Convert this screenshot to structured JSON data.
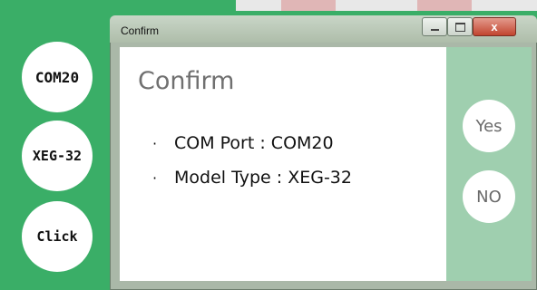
{
  "left_buttons": {
    "port": "COM20",
    "model": "XEG-32",
    "click": "Click"
  },
  "window": {
    "title": "Confirm",
    "close_glyph": "x"
  },
  "dialog": {
    "heading": "Confirm",
    "bullet": "·",
    "com_port_line": "COM Port : COM20",
    "model_type_line": "Model Type : XEG-32",
    "yes_label": "Yes",
    "no_label": "NO"
  },
  "colors": {
    "background_green": "#3aae67",
    "panel_green": "#9fcfaf",
    "close_red": "#c2452f"
  }
}
